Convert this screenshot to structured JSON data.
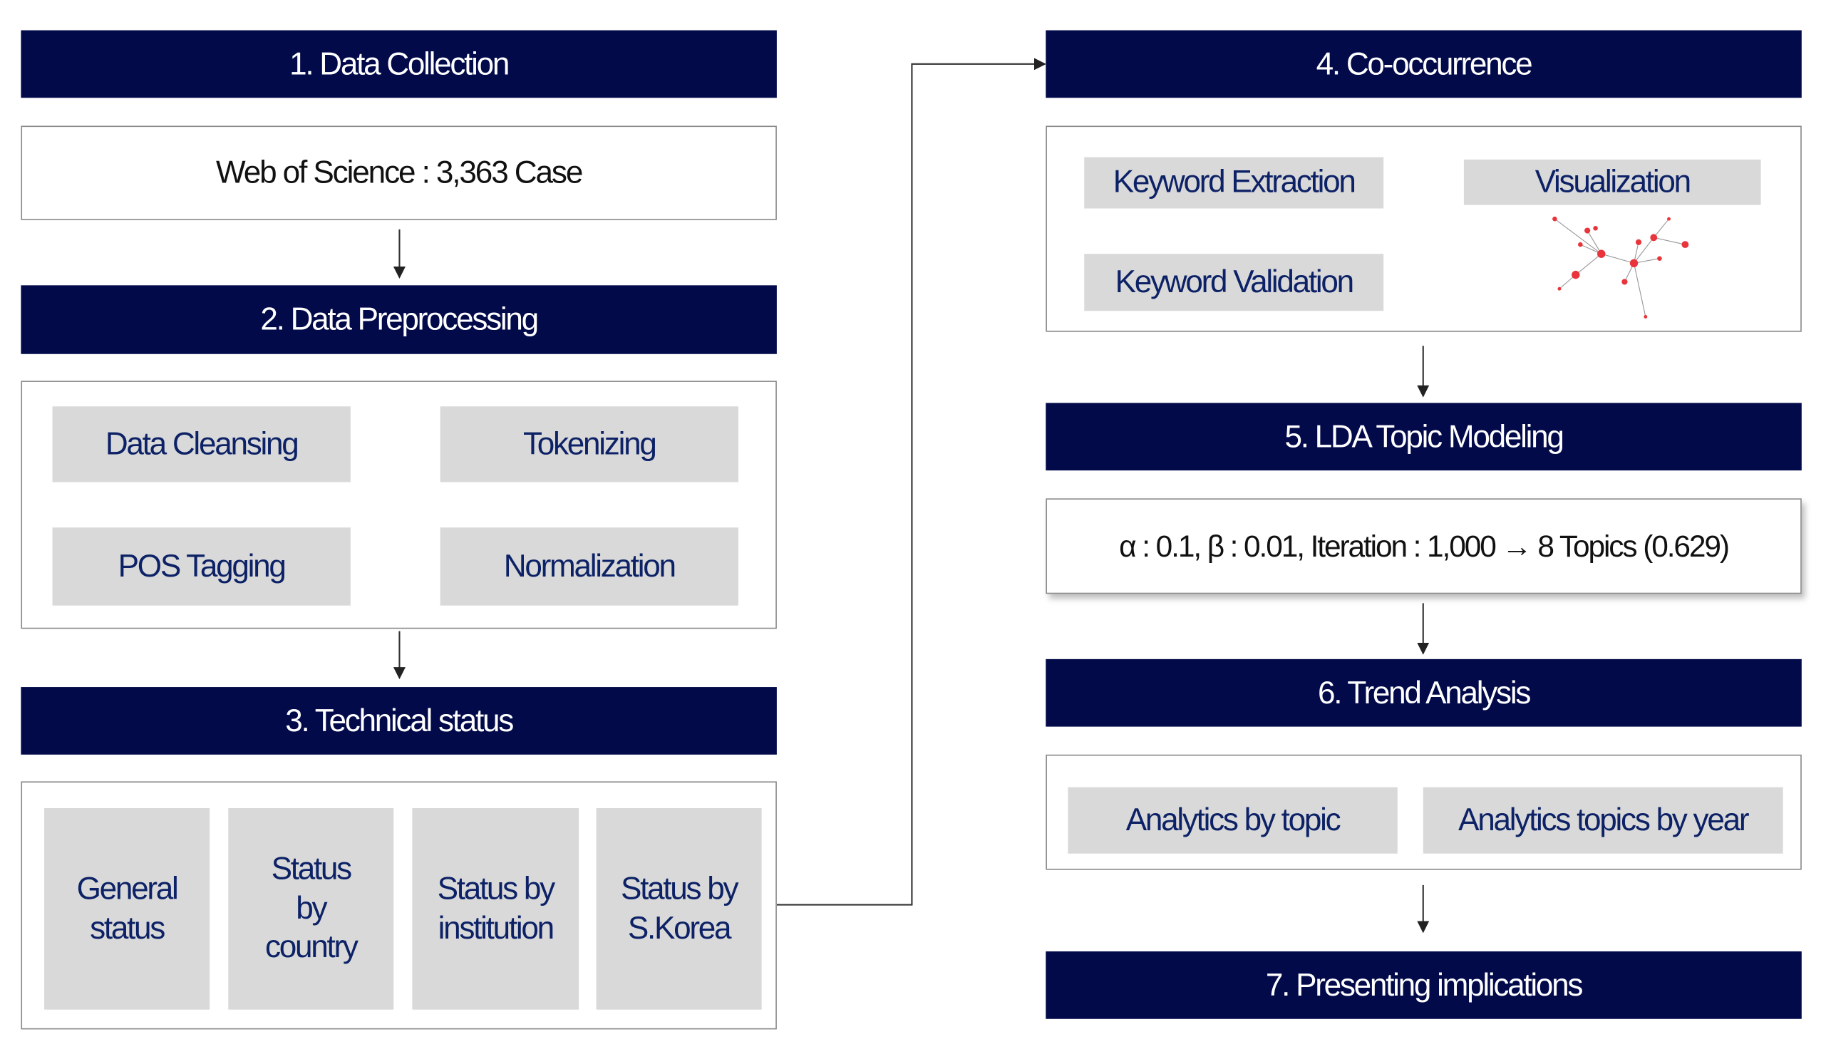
{
  "left": {
    "step1": {
      "title": "1. Data Collection",
      "source": "Web of Science : 3,363 Case"
    },
    "step2": {
      "title": "2. Data Preprocessing",
      "items": [
        "Data Cleansing",
        "Tokenizing",
        "POS Tagging",
        "Normalization"
      ]
    },
    "step3": {
      "title": "3. Technical status",
      "items": [
        "General status",
        "Status by country",
        "Status by institution",
        "Status by S.Korea"
      ]
    }
  },
  "right": {
    "step4": {
      "title": "4. Co-occurrence",
      "items": [
        "Keyword Extraction",
        "Keyword Validation",
        "Visualization"
      ]
    },
    "step5": {
      "title": "5. LDA Topic Modeling",
      "params": "α : 0.1,  β : 0.01, Iteration : 1,000 → 8 Topics (0.629)"
    },
    "step6": {
      "title": "6. Trend Analysis",
      "items": [
        "Analytics by topic",
        "Analytics topics by year"
      ]
    },
    "step7": {
      "title": "7. Presenting implications"
    }
  },
  "colors": {
    "header": "#020a4a",
    "cell": "#d9d9d9",
    "cell_text": "#0d2266",
    "network_node": "#e8343a"
  }
}
